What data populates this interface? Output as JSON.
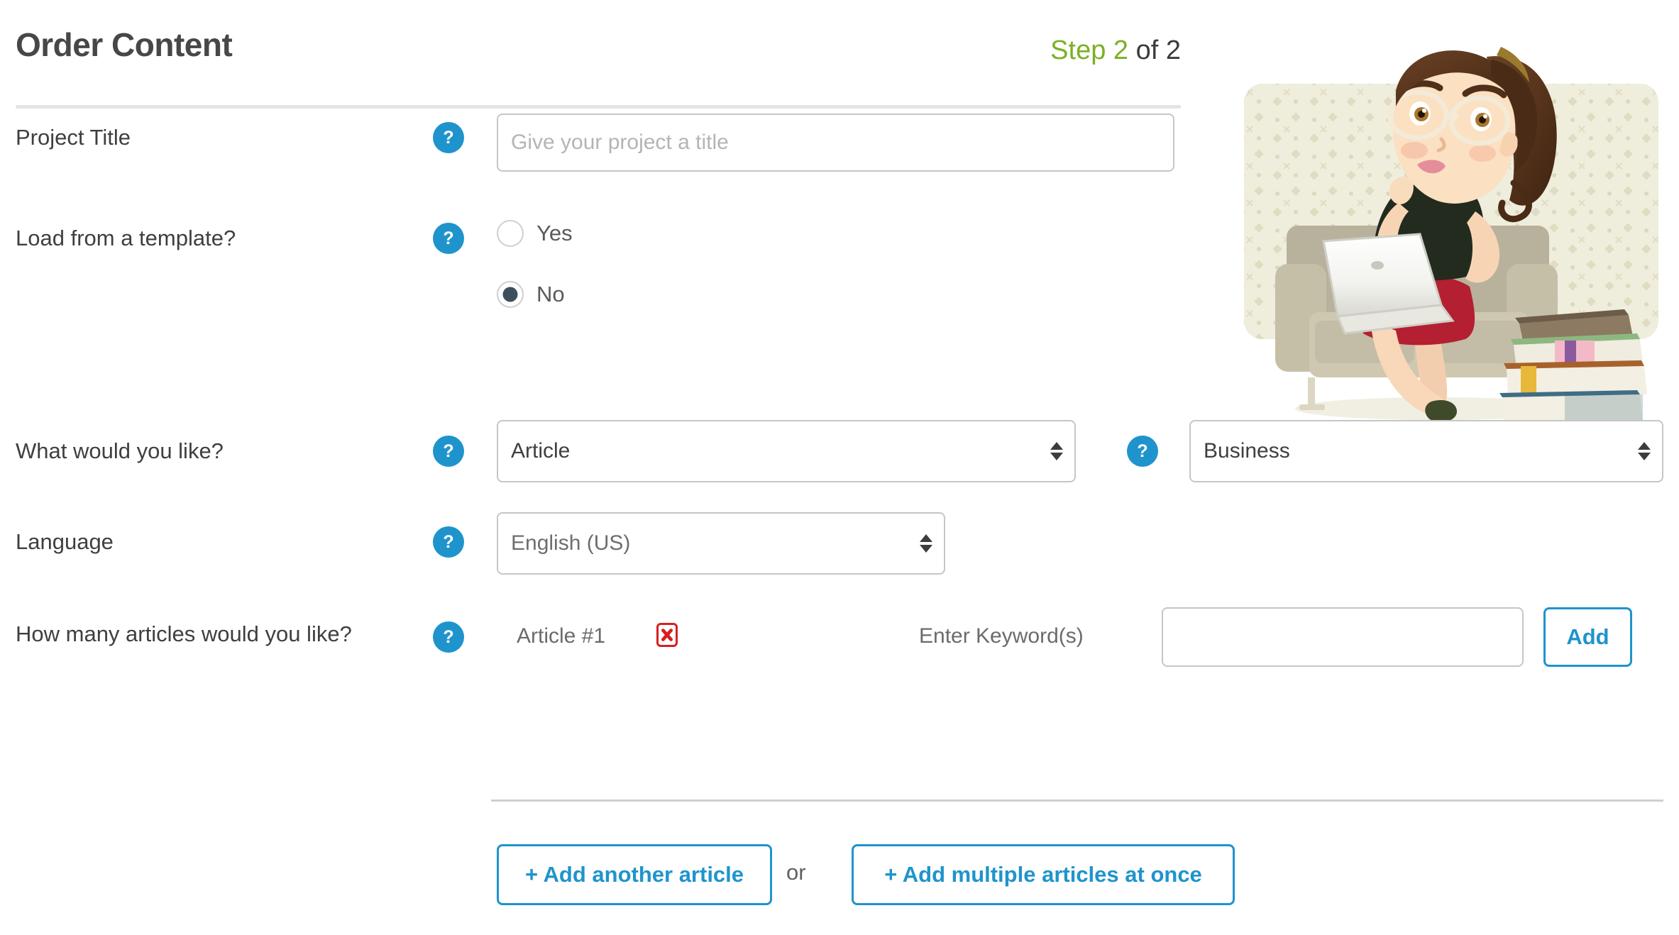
{
  "header": {
    "title": "Order Content",
    "step_current": "Step 2",
    "step_total": "of 2"
  },
  "illustration": {
    "name": "woman-writing-on-laptop-illustration"
  },
  "help_icon_glyph": "?",
  "fields": {
    "project_title": {
      "label": "Project Title",
      "placeholder": "Give your project a title",
      "value": ""
    },
    "load_template": {
      "label": "Load from a template?",
      "options": [
        {
          "label": "Yes",
          "selected": false
        },
        {
          "label": "No",
          "selected": true
        }
      ]
    },
    "what_would_you_like": {
      "label": "What would you like?",
      "content_type": "Article",
      "category": "Business"
    },
    "language": {
      "label": "Language",
      "value": "English (US)"
    },
    "how_many_articles": {
      "label": "How many articles would you like?",
      "article_name": "Article #1",
      "keyword_label": "Enter Keyword(s)",
      "keyword_value": "",
      "add_button": "Add",
      "delete_icon": "delete-article-icon"
    }
  },
  "footer": {
    "add_another": "+ Add another article",
    "or": "or",
    "add_multiple": "+ Add multiple articles at once"
  },
  "colors": {
    "accent_blue": "#1f94cc",
    "step_green": "#7cb024",
    "radio_fill": "#3d4f5c",
    "delete_red": "#d81f1f",
    "border_gray": "#c6c6c6"
  }
}
